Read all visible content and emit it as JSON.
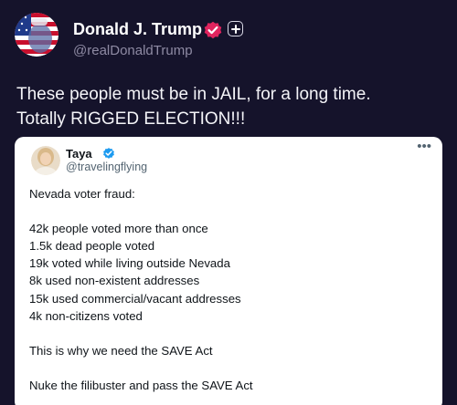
{
  "author": {
    "display_name": "Donald J. Trump",
    "handle": "@realDonaldTrump",
    "verified_color": "#e0245e"
  },
  "post": {
    "lines": [
      "These people must be in JAIL, for a long time.",
      "Totally RIGGED ELECTION!!!"
    ]
  },
  "quote": {
    "author": {
      "display_name": "Taya",
      "handle": "@travelingflying",
      "verified_color": "#1d9bf0"
    },
    "heading": "Nevada voter fraud:",
    "list": [
      "42k people voted more than once",
      "1.5k dead people voted",
      "19k voted while living outside Nevada",
      "8k used non-existent addresses",
      "15k used commercial/vacant addresses",
      "4k non-citizens voted"
    ],
    "closing_1": "This is why we need the SAVE Act",
    "closing_2": "Nuke the filibuster and pass the SAVE Act"
  },
  "icons": {
    "verified": "verified-badge-icon",
    "plus": "plus-icon",
    "more": "more-options-icon"
  },
  "colors": {
    "background": "#15132b",
    "card": "#ffffff",
    "text_muted": "#8e8aa3"
  }
}
